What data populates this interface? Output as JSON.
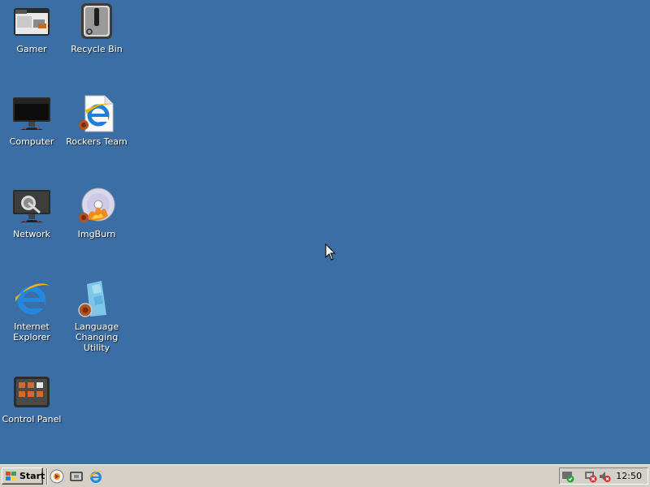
{
  "desktop": {
    "background_color": "#3a6ea5",
    "icons": [
      {
        "label": "Gamer",
        "icon": "gamer-folder-icon"
      },
      {
        "label": "Recycle Bin",
        "icon": "recycle-bin-icon"
      },
      {
        "label": "Computer",
        "icon": "computer-monitor-icon"
      },
      {
        "label": "Rockers Team",
        "icon": "ie-document-icon"
      },
      {
        "label": "Network",
        "icon": "network-satellite-icon"
      },
      {
        "label": "ImgBurn",
        "icon": "imgburn-disc-icon"
      },
      {
        "label": "Internet\nExplorer",
        "icon": "internet-explorer-icon"
      },
      {
        "label": "Language\nChanging Utility",
        "icon": "language-utility-icon"
      },
      {
        "label": "Control Panel",
        "icon": "control-panel-icon"
      }
    ]
  },
  "taskbar": {
    "start_label": "Start",
    "quick_launch": [
      "media-player-icon",
      "show-desktop-icon",
      "internet-explorer-icon"
    ],
    "tray_icons": [
      "security-shield-icon",
      "network-disconnected-icon",
      "volume-muted-icon"
    ],
    "clock": "12:50"
  }
}
